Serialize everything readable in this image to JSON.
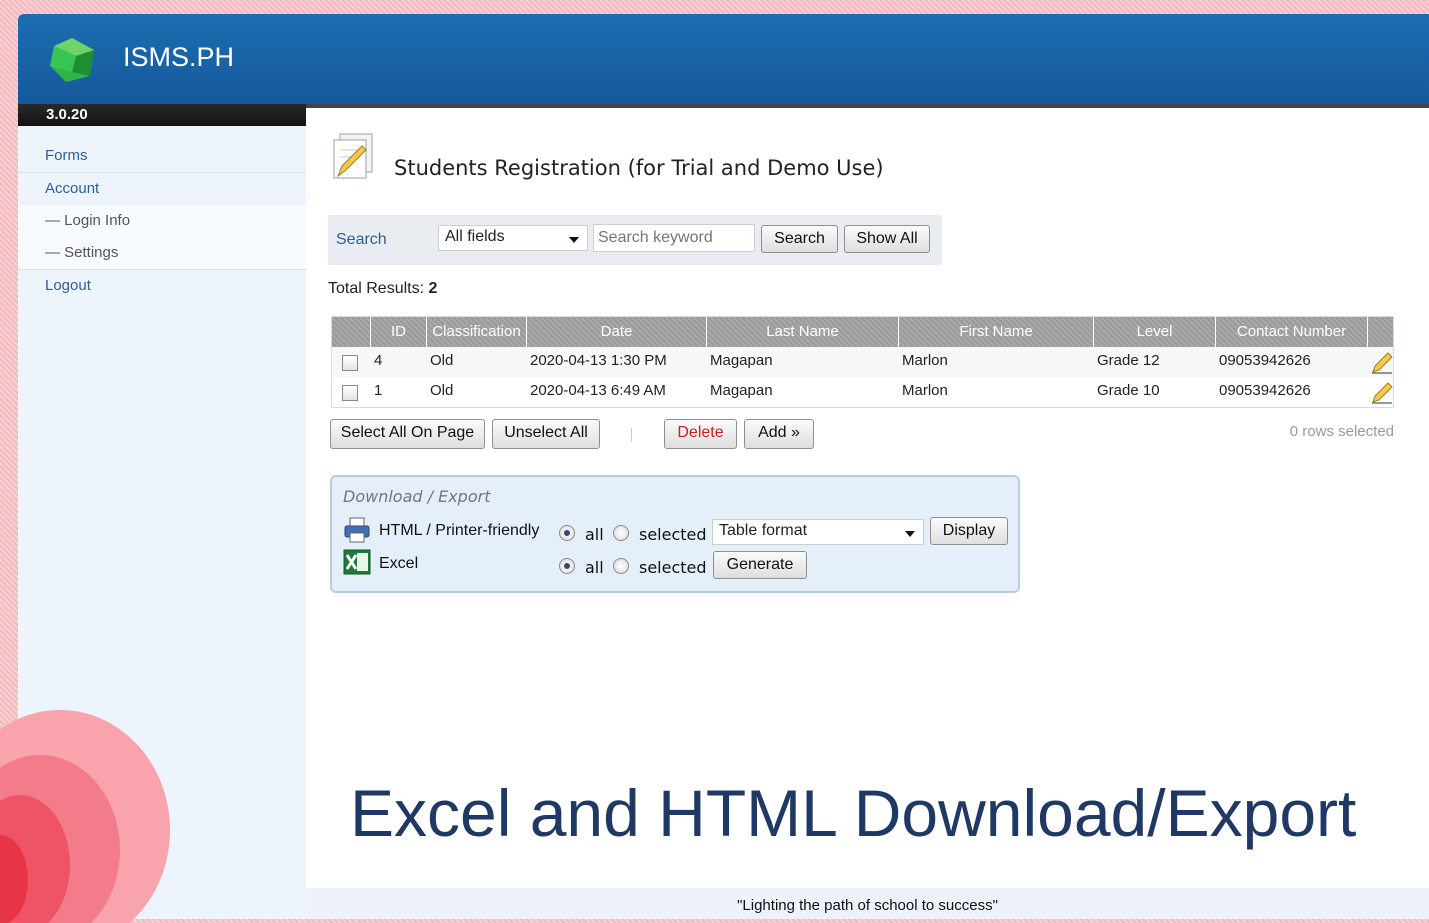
{
  "app": {
    "title": "ISMS.PH",
    "version": "3.0.20",
    "logo_icon": "green-gem-icon"
  },
  "sidebar": {
    "items": [
      {
        "label": "Forms"
      },
      {
        "label": "Account"
      },
      {
        "label": "— Login Info"
      },
      {
        "label": "— Settings"
      },
      {
        "label": "Logout"
      }
    ]
  },
  "page": {
    "title": "Students Registration (for Trial and Demo Use)",
    "icon": "form-edit-icon"
  },
  "search": {
    "label": "Search",
    "field_selected": "All fields",
    "placeholder": "Search keyword",
    "search_label": "Search",
    "show_all_label": "Show All"
  },
  "results": {
    "label": "Total Results:",
    "count": "2"
  },
  "table": {
    "columns": [
      "ID",
      "Classification",
      "Date",
      "Last Name",
      "First Name",
      "Level",
      "Contact Number"
    ],
    "rows": [
      {
        "id": "4",
        "classification": "Old",
        "date": "2020-04-13 1:30 PM",
        "last_name": "Magapan",
        "first_name": "Marlon",
        "level": "Grade 12",
        "contact": "09053942626"
      },
      {
        "id": "1",
        "classification": "Old",
        "date": "2020-04-13 6:49 AM",
        "last_name": "Magapan",
        "first_name": "Marlon",
        "level": "Grade 10",
        "contact": "09053942626"
      }
    ]
  },
  "actions": {
    "select_all_label": "Select All On Page",
    "unselect_all_label": "Unselect All",
    "delete_label": "Delete",
    "add_label": "Add »",
    "rows_selected": "0 rows selected"
  },
  "export": {
    "title": "Download / Export",
    "html_label": "HTML / Printer-friendly",
    "excel_label": "Excel",
    "all_label": "all",
    "selected_label": "selected",
    "format_selected": "Table format",
    "display_label": "Display",
    "generate_label": "Generate"
  },
  "caption": "Excel and HTML Download/Export",
  "footer": {
    "tagline": "\"Lighting the path of school to success\""
  },
  "colors": {
    "header_blue": "#1d6db3",
    "accent_link": "#2f5f95",
    "caption": "#1f3864"
  }
}
